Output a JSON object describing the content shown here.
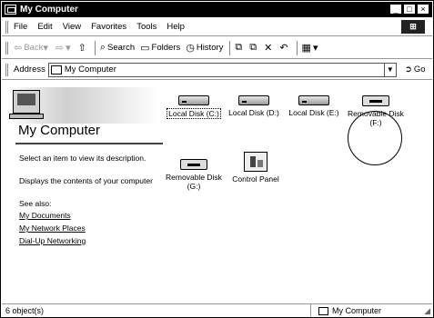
{
  "window": {
    "title": "My Computer",
    "controls": [
      "_",
      "□",
      "×"
    ]
  },
  "menu": {
    "items": [
      "File",
      "Edit",
      "View",
      "Favorites",
      "Tools",
      "Help"
    ]
  },
  "toolbar": {
    "back": "Back",
    "search": "Search",
    "folders": "Folders",
    "history": "History"
  },
  "address": {
    "label": "Address",
    "value": "My Computer",
    "go": "Go"
  },
  "left_pane": {
    "heading": "My Computer",
    "prompt": "Select an item to view its description.",
    "description": "Displays the contents of your computer",
    "see_also": "See also:",
    "links": [
      "My Documents",
      "My Network Places",
      "Dial-Up Networking"
    ]
  },
  "items": [
    {
      "label": "Local Disk (C:)"
    },
    {
      "label": "Local Disk (D:)"
    },
    {
      "label": "Local Disk (E:)"
    },
    {
      "label": "Removable Disk (F:)"
    },
    {
      "label": "Removable Disk (G:)"
    },
    {
      "label": "Control Panel"
    }
  ],
  "status": {
    "left": "6 object(s)",
    "right": "My Computer"
  }
}
